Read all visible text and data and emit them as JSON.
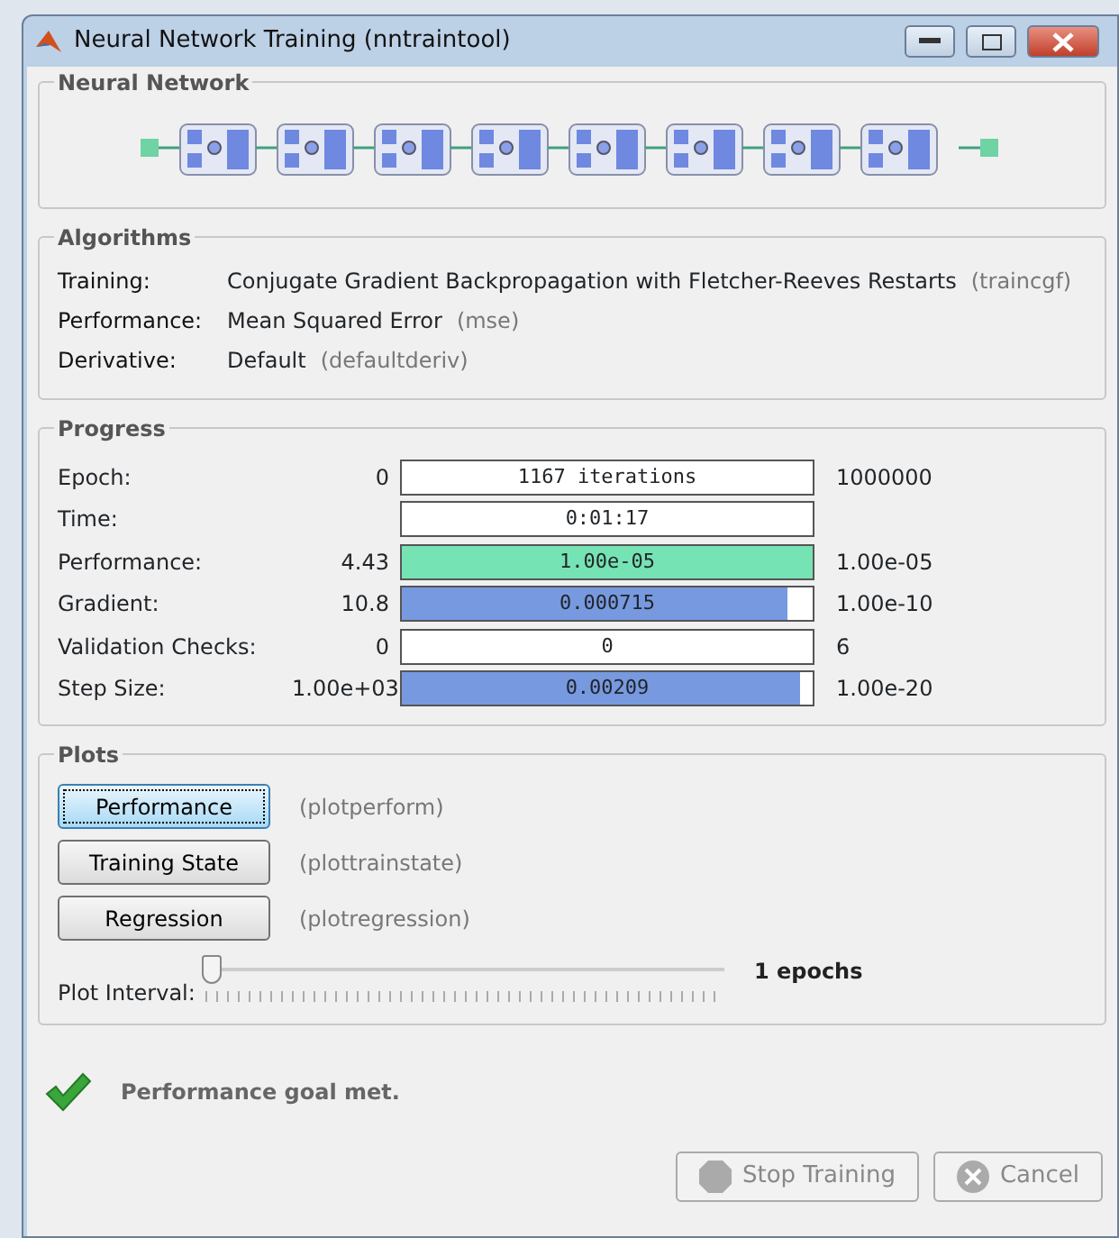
{
  "window": {
    "title": "Neural Network Training (nntraintool)"
  },
  "neural_network": {
    "title": "Neural Network"
  },
  "algorithms": {
    "title": "Algorithms",
    "rows": [
      {
        "label": "Training:",
        "value": "Conjugate Gradient Backpropagation with Fletcher-Reeves Restarts",
        "code": "(traincgf)"
      },
      {
        "label": "Performance:",
        "value": "Mean Squared Error",
        "code": "(mse)"
      },
      {
        "label": "Derivative:",
        "value": "Default",
        "code": "(defaultderiv)"
      }
    ]
  },
  "progress": {
    "title": "Progress",
    "rows": [
      {
        "label": "Epoch:",
        "start": "0",
        "reading": "1167 iterations",
        "end": "1000000"
      },
      {
        "label": "Time:",
        "reading": "0:01:17"
      },
      {
        "label": "Performance:",
        "start": "4.43",
        "reading": "1.00e-05",
        "level": 1,
        "color": "#76e3b4",
        "end": "1.00e-05"
      },
      {
        "label": "Gradient:",
        "start": "10.8",
        "reading": "0.000715",
        "level": 0.94,
        "color": "#7799e0",
        "end": "1.00e-10"
      },
      {
        "label": "Validation Checks:",
        "start": "0",
        "reading": "0",
        "end": "6"
      },
      {
        "label": "Step Size:",
        "start": "1.00e+03",
        "reading": "0.00209",
        "level": 0.97,
        "color": "#7799e0",
        "end": "1.00e-20"
      }
    ]
  },
  "plots": {
    "title": "Plots",
    "buttons": [
      {
        "label": "Performance",
        "code": "(plotperform)",
        "selected": true
      },
      {
        "label": "Training State",
        "code": "(plottrainstate)",
        "selected": false
      },
      {
        "label": "Regression",
        "code": "(plotregression)",
        "selected": false
      }
    ],
    "interval": {
      "label": "Plot Interval:",
      "level": 0,
      "reading": "1 epochs"
    }
  },
  "status": {
    "message": "Performance goal met."
  },
  "buttons": [
    {
      "label": "Stop Training",
      "kind": "stop",
      "disabled": true
    },
    {
      "label": "Cancel",
      "kind": "cancel",
      "disabled": true
    }
  ]
}
